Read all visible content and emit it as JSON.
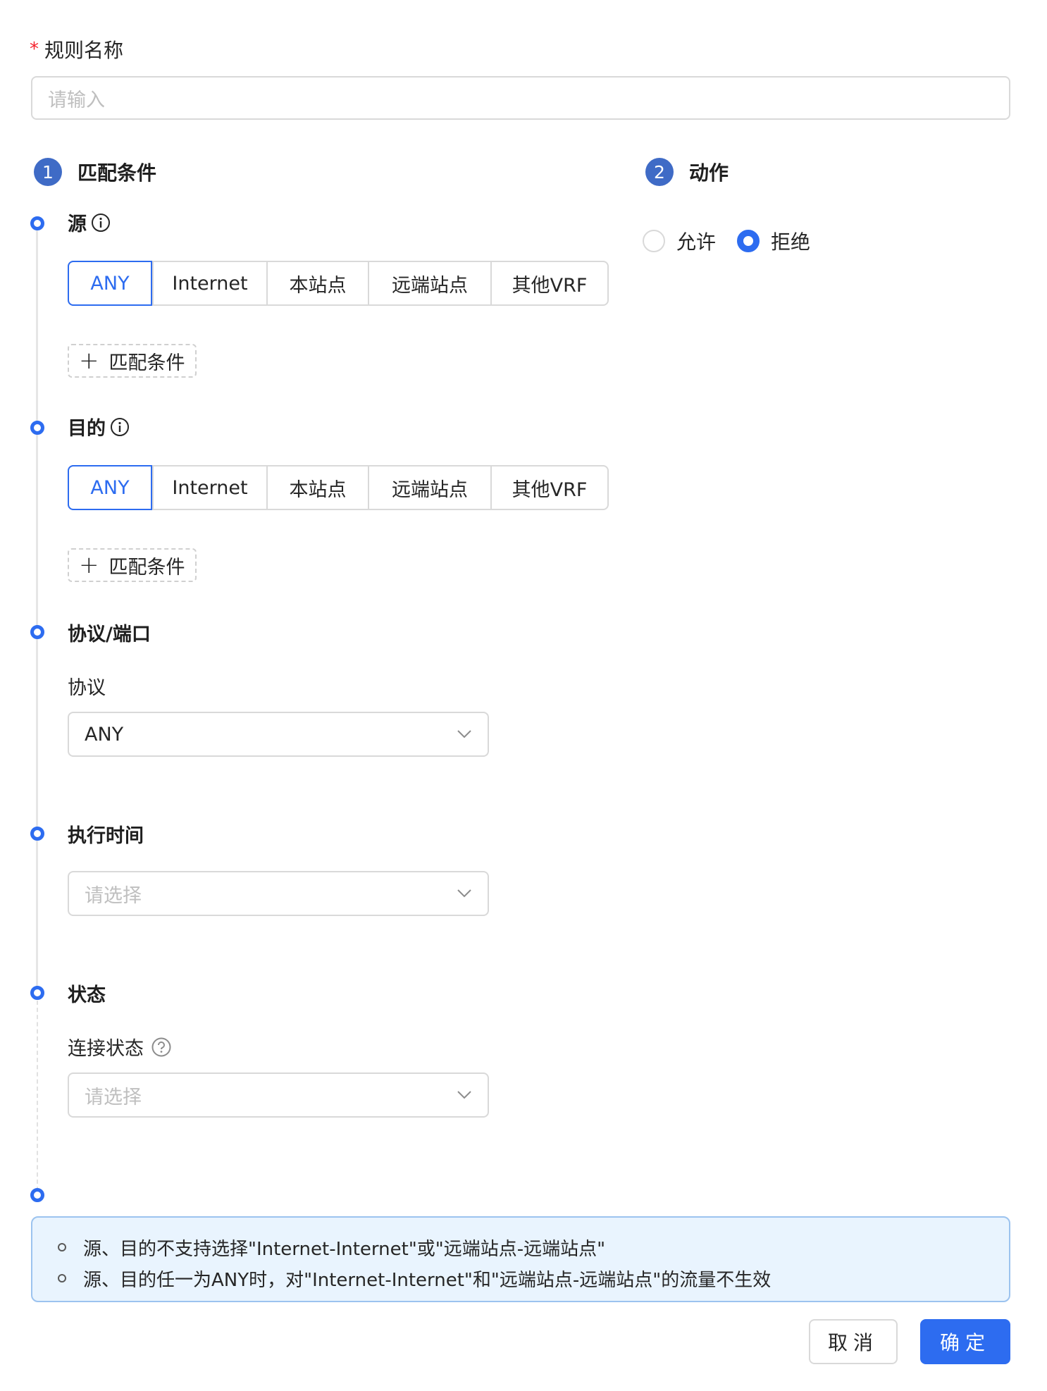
{
  "rule_name": {
    "required_mark": "*",
    "label": "规则名称",
    "placeholder": "请输入"
  },
  "steps": [
    {
      "number": "1",
      "title": "匹配条件"
    },
    {
      "number": "2",
      "title": "动作"
    }
  ],
  "source": {
    "title": "源",
    "options": [
      "ANY",
      "Internet",
      "本站点",
      "远端站点",
      "其他VRF"
    ],
    "selected": "ANY",
    "add_label": "匹配条件"
  },
  "destination": {
    "title": "目的",
    "options": [
      "ANY",
      "Internet",
      "本站点",
      "远端站点",
      "其他VRF"
    ],
    "selected": "ANY",
    "add_label": "匹配条件"
  },
  "protocol_port": {
    "title": "协议/端口",
    "protocol_label": "协议",
    "protocol_value": "ANY"
  },
  "schedule": {
    "title": "执行时间",
    "placeholder": "请选择"
  },
  "state": {
    "title": "状态",
    "connection_label": "连接状态",
    "placeholder": "请选择"
  },
  "action": {
    "options": [
      "允许",
      "拒绝"
    ],
    "selected": "拒绝"
  },
  "notice": [
    "源、目的不支持选择\"Internet-Internet\"或\"远端站点-远端站点\"",
    "源、目的任一为ANY时，对\"Internet-Internet\"和\"远端站点-远端站点\"的流量不生效"
  ],
  "footer": {
    "cancel": "取消",
    "confirm": "确定"
  },
  "colors": {
    "primary": "#2d6cf0",
    "step_badge": "#3f6bc6",
    "alert_bg": "#e9f4fe",
    "required": "#f5222d"
  }
}
